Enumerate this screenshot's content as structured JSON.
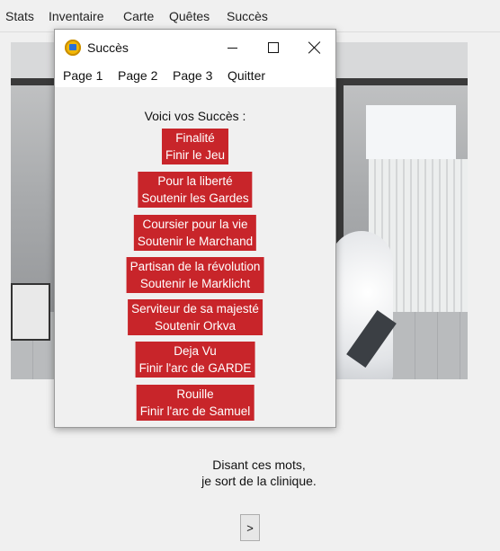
{
  "menubar": {
    "items": [
      {
        "label": "Stats"
      },
      {
        "label": "Inventaire"
      },
      {
        "label": "Carte"
      },
      {
        "label": "Quêtes"
      },
      {
        "label": "Succès"
      }
    ]
  },
  "dialog": {
    "title": "Succès",
    "icon": "achievements-app-icon",
    "menu": [
      {
        "label": "Page 1"
      },
      {
        "label": "Page 2"
      },
      {
        "label": "Page 3"
      },
      {
        "label": "Quitter"
      }
    ],
    "heading": "Voici vos Succès :",
    "achievements": [
      {
        "title": "Finalité",
        "description": "Finir le Jeu"
      },
      {
        "title": "Pour la liberté",
        "description": "Soutenir les Gardes"
      },
      {
        "title": "Coursier pour la vie",
        "description": "Soutenir le Marchand"
      },
      {
        "title": "Partisan de la révolution",
        "description": "Soutenir le Marklicht"
      },
      {
        "title": "Serviteur de sa majesté",
        "description": "Soutenir Orkva"
      },
      {
        "title": "Deja Vu",
        "description": "Finir l'arc de GARDE"
      },
      {
        "title": "Rouille",
        "description": "Finir l'arc de Samuel"
      }
    ]
  },
  "narration": {
    "line1": "Disant ces mots,",
    "line2": "je sort de la clinique."
  },
  "next_button": {
    "label": ">"
  },
  "colors": {
    "achievement_bg": "#c8252a",
    "achievement_text": "#ffffff",
    "window_bg": "#f0f0f0"
  }
}
